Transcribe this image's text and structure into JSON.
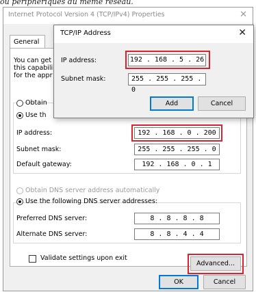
{
  "caption": "ou périphériques du même réseau.",
  "main_dialog": {
    "title": "Internet Protocol Version 4 (TCP/IPv4) Properties",
    "close_icon": "close-icon",
    "tab_general": "General",
    "intro_lines": [
      "You can get",
      "this capabili",
      "for the appr"
    ],
    "obtain_ip_auto": "Obtain",
    "use_following_ip": "Use th",
    "ip_label": "IP address:",
    "ip_value": "192 . 168 . 0 . 200",
    "subnet_label": "Subnet mask:",
    "subnet_value": "255 . 255 . 255 . 0",
    "gateway_label": "Default gateway:",
    "gateway_value": "192 . 168 . 0 . 1",
    "obtain_dns_auto": "Obtain DNS server address automatically",
    "use_following_dns": "Use the following DNS server addresses:",
    "preferred_dns_label": "Preferred DNS server:",
    "preferred_dns_value": "8 . 8 . 8 . 8",
    "alternate_dns_label": "Alternate DNS server:",
    "alternate_dns_value": "8 . 8 . 4 . 4",
    "validate_label": "Validate settings upon exit",
    "advanced_button": "Advanced...",
    "ok_button": "OK",
    "cancel_button": "Cancel"
  },
  "tcpip_dialog": {
    "title": "TCP/IP Address",
    "close_icon": "close-icon",
    "ip_label": "IP address:",
    "ip_value": "192 . 168 . 5 . 26",
    "subnet_label": "Subnet mask:",
    "subnet_value": "255 . 255 . 255 . 0",
    "add_button": "Add",
    "cancel_button": "Cancel"
  },
  "colors": {
    "highlight": "#d9242f",
    "focus": "#0078d7"
  }
}
